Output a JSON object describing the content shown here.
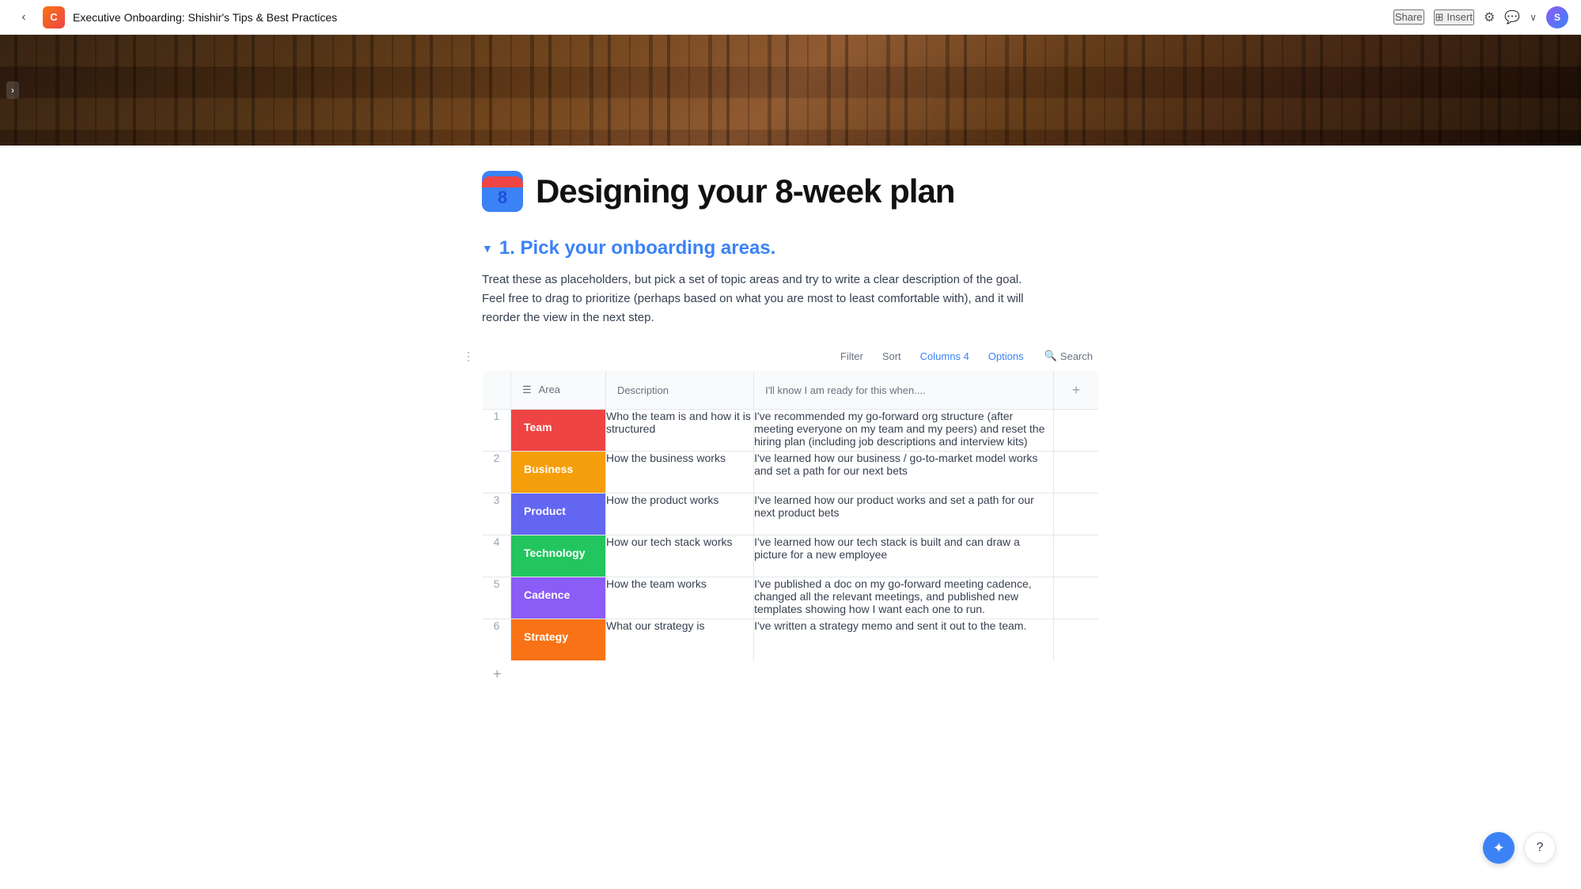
{
  "nav": {
    "back_label": "‹",
    "app_logo": "C",
    "doc_title": "Executive Onboarding: Shishir's Tips & Best Practices",
    "share_label": "Share",
    "insert_label": "Insert",
    "settings_icon": "⚙",
    "comment_icon": "💬",
    "chevron_icon": "∨",
    "avatar_initials": "S"
  },
  "hero": {
    "toggle_icon": "›"
  },
  "page": {
    "calendar_num": "8",
    "title": "Designing your 8-week plan"
  },
  "section": {
    "collapse_icon": "▼",
    "title": "1. Pick your onboarding areas.",
    "description_line1": "Treat these as placeholders, but pick a set of topic areas and try to write a clear description of the goal.",
    "description_line2": "Feel free to drag to prioritize (perhaps based on what you are most to least comfortable with), and it will",
    "description_line3": "reorder the view in the next step."
  },
  "toolbar": {
    "filter_label": "Filter",
    "sort_label": "Sort",
    "columns_label": "Columns 4",
    "options_label": "Options",
    "search_icon": "🔍",
    "search_label": "Search",
    "dots_icon": "⋮"
  },
  "table": {
    "columns": [
      {
        "id": "num",
        "label": ""
      },
      {
        "id": "area",
        "label": "Area",
        "icon": "☰"
      },
      {
        "id": "description",
        "label": "Description"
      },
      {
        "id": "ready",
        "label": "I'll know I am ready for this when...."
      }
    ],
    "rows": [
      {
        "num": "1",
        "area": "Team",
        "area_class": "area-team",
        "description": "Who the team is and how it is structured",
        "ready": "I've recommended my go-forward org structure (after meeting everyone on my team and my peers) and reset the hiring plan (including job descriptions and interview kits)"
      },
      {
        "num": "2",
        "area": "Business",
        "area_class": "area-business",
        "description": "How the business works",
        "ready": "I've learned how our business / go-to-market model works and set a path for our next bets"
      },
      {
        "num": "3",
        "area": "Product",
        "area_class": "area-product",
        "description": "How the product works",
        "ready": "I've learned how our product works and set a path for our next product bets"
      },
      {
        "num": "4",
        "area": "Technology",
        "area_class": "area-technology",
        "description": "How our tech stack works",
        "ready": "I've learned how our tech stack is built and can draw a picture for a new employee"
      },
      {
        "num": "5",
        "area": "Cadence",
        "area_class": "area-cadence",
        "description": "How the team works",
        "ready": "I've published a doc on my go-forward meeting cadence, changed all the relevant meetings, and published new templates showing how I want each one to run."
      },
      {
        "num": "6",
        "area": "Strategy",
        "area_class": "area-strategy",
        "description": "What our strategy is",
        "ready": "I've written a strategy memo and sent it out to the team."
      }
    ],
    "add_col_icon": "+",
    "add_row_icon": "+"
  },
  "fab": {
    "star_icon": "✦",
    "help_icon": "?"
  }
}
